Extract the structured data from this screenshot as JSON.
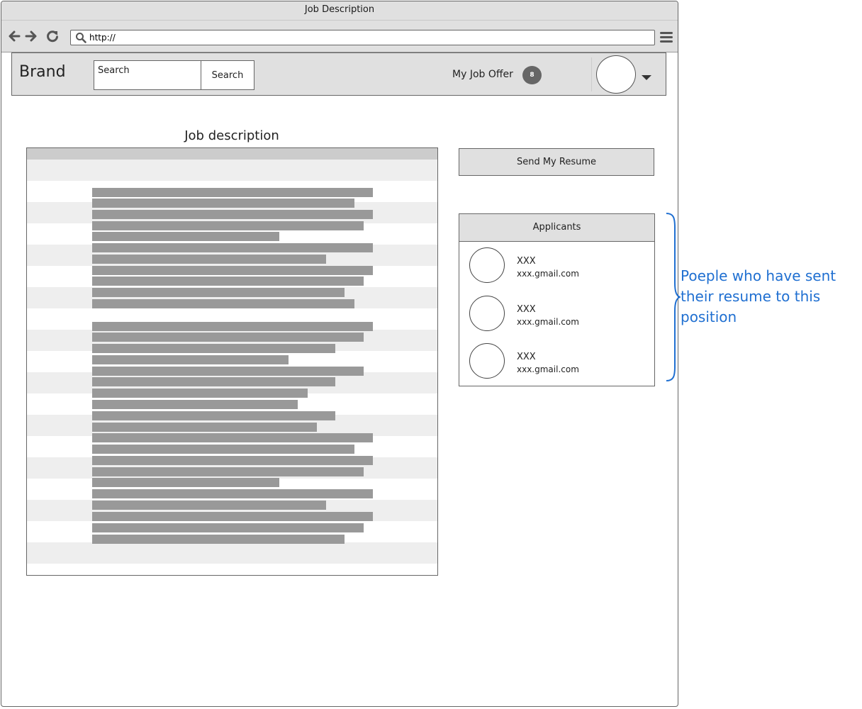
{
  "window": {
    "title": "Job Description"
  },
  "browser": {
    "url": "http://"
  },
  "nav": {
    "brand": "Brand",
    "search_placeholder": "Search",
    "search_button": "Search",
    "job_offer_label": "My Job Offer",
    "job_offer_count": "8"
  },
  "job": {
    "title": "Job description"
  },
  "actions": {
    "send_resume": "Send My Resume"
  },
  "applicants": {
    "title": "Applicants",
    "items": [
      {
        "name": "XXX",
        "email": "xxx.gmail.com"
      },
      {
        "name": "XXX",
        "email": "xxx.gmail.com"
      },
      {
        "name": "XXX",
        "email": "xxx.gmail.com"
      }
    ]
  },
  "annotation": {
    "text": "Poeple who have sent their resume to this position"
  },
  "colors": {
    "chrome": "#e0e0e0",
    "annotation": "#1f6fd1",
    "text_placeholder": "#999999"
  }
}
